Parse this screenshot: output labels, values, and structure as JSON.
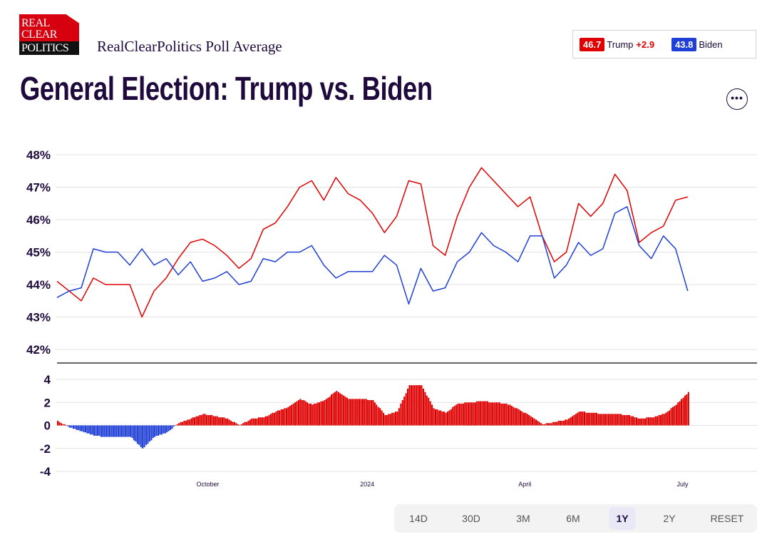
{
  "header": {
    "logo_text": [
      "REAL",
      "CLEAR",
      "POLITICS"
    ],
    "subtitle": "RealClearPolitics Poll Average",
    "title": "General Election: Trump vs. Biden",
    "more_icon": "ellipsis-icon"
  },
  "legend": {
    "trump": {
      "value": "46.7",
      "name": "Trump",
      "spread": "+2.9",
      "color": "#e00000"
    },
    "biden": {
      "value": "43.8",
      "name": "Biden",
      "color": "#1f3fd6"
    }
  },
  "ranges": {
    "buttons": [
      "14D",
      "30D",
      "3M",
      "6M",
      "1Y",
      "2Y",
      "RESET"
    ],
    "active": "1Y"
  },
  "chart_data": [
    {
      "type": "line",
      "ylim": [
        42,
        48
      ],
      "y_ticks": [
        "48%",
        "47%",
        "46%",
        "45%",
        "44%",
        "43%",
        "42%"
      ],
      "x_range": [
        "2023-07-06",
        "2024-08-13"
      ],
      "grid": true,
      "x": [
        "2023-07-06",
        "2023-07-13",
        "2023-07-20",
        "2023-07-27",
        "2023-08-03",
        "2023-08-10",
        "2023-08-17",
        "2023-08-24",
        "2023-08-31",
        "2023-09-07",
        "2023-09-14",
        "2023-09-21",
        "2023-09-28",
        "2023-10-05",
        "2023-10-12",
        "2023-10-19",
        "2023-10-26",
        "2023-11-02",
        "2023-11-09",
        "2023-11-16",
        "2023-11-23",
        "2023-11-30",
        "2023-12-07",
        "2023-12-14",
        "2023-12-21",
        "2023-12-28",
        "2024-01-04",
        "2024-01-11",
        "2024-01-18",
        "2024-01-25",
        "2024-02-01",
        "2024-02-08",
        "2024-02-15",
        "2024-02-22",
        "2024-02-29",
        "2024-03-07",
        "2024-03-14",
        "2024-03-21",
        "2024-03-28",
        "2024-04-04",
        "2024-04-11",
        "2024-04-18",
        "2024-04-25",
        "2024-05-02",
        "2024-05-09",
        "2024-05-16",
        "2024-05-23",
        "2024-05-30",
        "2024-06-06",
        "2024-06-13",
        "2024-06-20",
        "2024-06-27",
        "2024-07-04"
      ],
      "series": [
        {
          "name": "Trump",
          "color": "#e00000",
          "values": [
            44.1,
            43.8,
            43.5,
            44.2,
            44.0,
            44.0,
            44.0,
            43.0,
            43.8,
            44.2,
            44.8,
            45.3,
            45.4,
            45.2,
            44.9,
            44.5,
            44.8,
            45.7,
            45.9,
            46.4,
            47.0,
            47.2,
            46.6,
            47.3,
            46.8,
            46.6,
            46.2,
            45.6,
            46.1,
            47.2,
            47.1,
            45.2,
            44.9,
            46.1,
            47.0,
            47.6,
            47.2,
            46.8,
            46.4,
            46.7,
            45.5,
            44.7,
            45.0,
            46.5,
            46.1,
            46.5,
            47.4,
            46.9,
            45.3,
            45.6,
            45.8,
            46.6,
            46.7
          ]
        },
        {
          "name": "Biden",
          "color": "#1f3fd6",
          "values": [
            43.6,
            43.8,
            43.9,
            45.1,
            45.0,
            45.0,
            44.6,
            45.1,
            44.6,
            44.8,
            44.3,
            44.7,
            44.1,
            44.2,
            44.4,
            44.0,
            44.1,
            44.8,
            44.7,
            45.0,
            45.0,
            45.2,
            44.6,
            44.2,
            44.4,
            44.4,
            44.4,
            44.9,
            44.6,
            43.4,
            44.5,
            43.8,
            43.9,
            44.7,
            45.0,
            45.6,
            45.2,
            45.0,
            44.7,
            45.5,
            45.5,
            44.2,
            44.6,
            45.3,
            44.9,
            45.1,
            46.2,
            46.4,
            45.2,
            44.8,
            45.5,
            45.1,
            43.8
          ]
        }
      ]
    },
    {
      "type": "bar",
      "ylim": [
        -4,
        4
      ],
      "y_ticks": [
        "4",
        "2",
        "0",
        "-2",
        "-4"
      ],
      "x_ticks": [
        "October",
        "2024",
        "April",
        "July"
      ],
      "positive_color": "#e00000",
      "negative_color": "#1f3fd6",
      "values": [
        0.4,
        -0.2,
        -0.5,
        -0.9,
        -1.0,
        -1.0,
        -1.0,
        -2.0,
        -1.0,
        -0.6,
        0.2,
        0.6,
        1.0,
        0.8,
        0.6,
        0.0,
        0.6,
        0.7,
        1.2,
        1.6,
        2.3,
        1.8,
        2.2,
        3.0,
        2.3,
        2.3,
        2.2,
        0.9,
        1.2,
        3.5,
        3.5,
        1.5,
        1.1,
        1.9,
        2.0,
        2.1,
        2.0,
        1.9,
        1.4,
        0.8,
        0.1,
        0.3,
        0.5,
        1.2,
        1.1,
        1.0,
        1.0,
        0.9,
        0.6,
        0.7,
        1.0,
        1.8,
        2.9
      ]
    }
  ]
}
